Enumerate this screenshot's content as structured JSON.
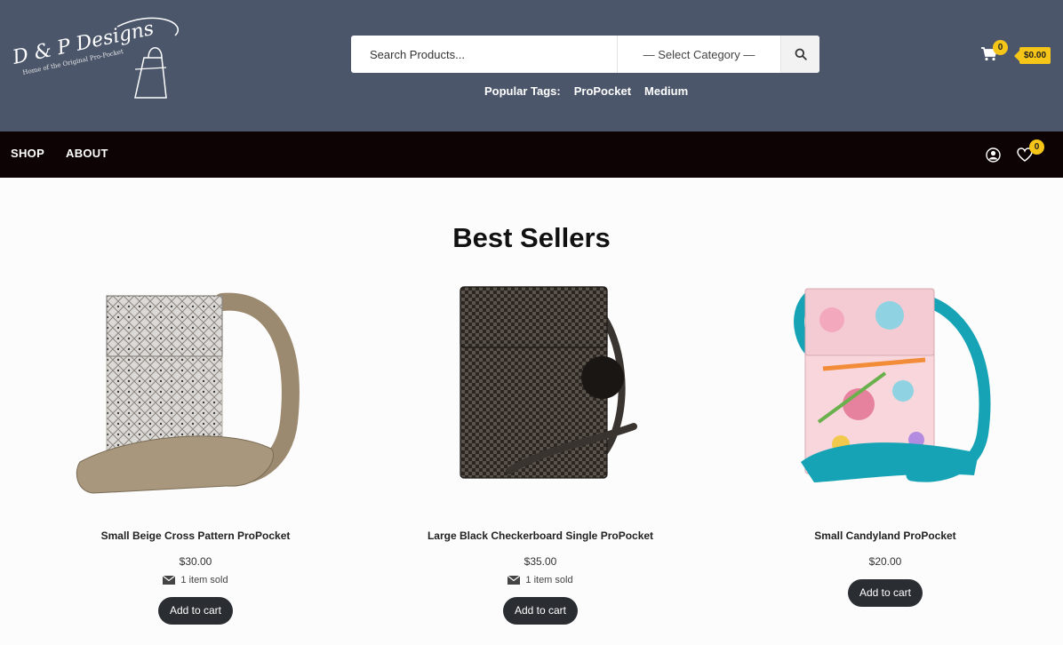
{
  "brand": {
    "logo_text": "D & P Designs",
    "logo_tagline": "Home of the Original Pro-Pocket"
  },
  "search": {
    "placeholder": "Search Products...",
    "category_selected": "— Select Category —"
  },
  "tags": {
    "label": "Popular Tags:",
    "items": [
      "ProPocket",
      "Medium"
    ]
  },
  "cart": {
    "count": "0",
    "total": "$0.00"
  },
  "nav": {
    "items": [
      "SHOP",
      "ABOUT"
    ],
    "wishlist_count": "0"
  },
  "main": {
    "section_title": "Best Sellers",
    "products": [
      {
        "name": "Small Beige Cross Pattern ProPocket",
        "price": "$30.00",
        "sold": "1 item sold",
        "button": "Add to cart"
      },
      {
        "name": "Large Black Checkerboard Single ProPocket",
        "price": "$35.00",
        "sold": "1 item sold",
        "button": "Add to cart"
      },
      {
        "name": "Small Candyland ProPocket",
        "price": "$20.00",
        "button": "Add to cart"
      }
    ]
  },
  "colors": {
    "header_bg": "#4b566b",
    "nav_bg": "#0d0304",
    "accent_yellow": "#f5c518",
    "button_dark": "#2a2e33"
  }
}
